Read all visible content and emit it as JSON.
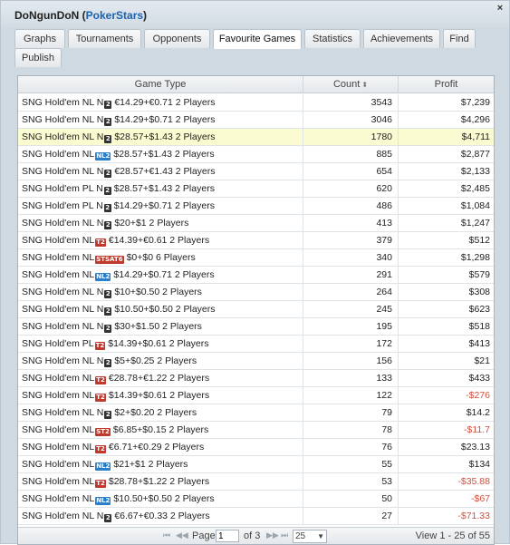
{
  "window": {
    "title": "DoNgunDoN",
    "site": "PokerStars",
    "close_glyph": "×"
  },
  "tabs": [
    {
      "label": "Graphs"
    },
    {
      "label": "Tournaments"
    },
    {
      "label": "Opponents"
    },
    {
      "label": "Favourite Games",
      "active": true
    },
    {
      "label": "Statistics"
    },
    {
      "label": "Achievements"
    },
    {
      "label": "Find"
    },
    {
      "label": "Publish"
    }
  ],
  "grid": {
    "columns": {
      "game_type": "Game Type",
      "count": "Count",
      "profit": "Profit",
      "sort_glyph": "⬍"
    },
    "rows": [
      {
        "game": "SNG Hold'em NL N",
        "badge": "n2",
        "rest": "€14.29+€0.71 2 Players",
        "count": "3543",
        "profit": "$7,239",
        "neg": false
      },
      {
        "game": "SNG Hold'em NL N",
        "badge": "n2",
        "rest": "$14.29+$0.71 2 Players",
        "count": "3046",
        "profit": "$4,296",
        "neg": false
      },
      {
        "game": "SNG Hold'em NL N",
        "badge": "n2",
        "rest": "$28.57+$1.43 2 Players",
        "count": "1780",
        "profit": "$4,711",
        "neg": false,
        "selected": true
      },
      {
        "game": "SNG Hold'em NL",
        "badge": "nl2",
        "rest": "$28.57+$1.43 2 Players",
        "count": "885",
        "profit": "$2,877",
        "neg": false
      },
      {
        "game": "SNG Hold'em NL N",
        "badge": "n2",
        "rest": "€28.57+€1.43 2 Players",
        "count": "654",
        "profit": "$2,133",
        "neg": false
      },
      {
        "game": "SNG Hold'em PL N",
        "badge": "n2",
        "rest": "$28.57+$1.43 2 Players",
        "count": "620",
        "profit": "$2,485",
        "neg": false
      },
      {
        "game": "SNG Hold'em PL N",
        "badge": "n2",
        "rest": "$14.29+$0.71 2 Players",
        "count": "486",
        "profit": "$1,084",
        "neg": false
      },
      {
        "game": "SNG Hold'em NL N",
        "badge": "n2",
        "rest": "$20+$1 2 Players",
        "count": "413",
        "profit": "$1,247",
        "neg": false
      },
      {
        "game": "SNG Hold'em NL",
        "badge": "t2",
        "rest": "€14.39+€0.61 2 Players",
        "count": "379",
        "profit": "$512",
        "neg": false
      },
      {
        "game": "SNG Hold'em NL",
        "badge": "st6",
        "rest": "$0+$0 6 Players",
        "count": "340",
        "profit": "$1,298",
        "neg": false
      },
      {
        "game": "SNG Hold'em NL",
        "badge": "nl2",
        "rest": "$14.29+$0.71 2 Players",
        "count": "291",
        "profit": "$579",
        "neg": false
      },
      {
        "game": "SNG Hold'em NL N",
        "badge": "n2",
        "rest": "$10+$0.50 2 Players",
        "count": "264",
        "profit": "$308",
        "neg": false
      },
      {
        "game": "SNG Hold'em NL N",
        "badge": "n2",
        "rest": "$10.50+$0.50 2 Players",
        "count": "245",
        "profit": "$623",
        "neg": false
      },
      {
        "game": "SNG Hold'em NL N",
        "badge": "n2",
        "rest": "$30+$1.50 2 Players",
        "count": "195",
        "profit": "$518",
        "neg": false
      },
      {
        "game": "SNG Hold'em PL",
        "badge": "t2",
        "rest": "$14.39+$0.61 2 Players",
        "count": "172",
        "profit": "$413",
        "neg": false
      },
      {
        "game": "SNG Hold'em NL N",
        "badge": "n2",
        "rest": "$5+$0.25 2 Players",
        "count": "156",
        "profit": "$21",
        "neg": false
      },
      {
        "game": "SNG Hold'em NL",
        "badge": "t2",
        "rest": "€28.78+€1.22 2 Players",
        "count": "133",
        "profit": "$433",
        "neg": false
      },
      {
        "game": "SNG Hold'em NL",
        "badge": "t2",
        "rest": "$14.39+$0.61 2 Players",
        "count": "122",
        "profit": "-$276",
        "neg": true
      },
      {
        "game": "SNG Hold'em NL N",
        "badge": "n2",
        "rest": "$2+$0.20 2 Players",
        "count": "79",
        "profit": "$14.2",
        "neg": false
      },
      {
        "game": "SNG Hold'em NL",
        "badge": "st2",
        "rest": "$6.85+$0.15 2 Players",
        "count": "78",
        "profit": "-$11.7",
        "neg": true
      },
      {
        "game": "SNG Hold'em NL",
        "badge": "t2",
        "rest": "€6.71+€0.29 2 Players",
        "count": "76",
        "profit": "$23.13",
        "neg": false
      },
      {
        "game": "SNG Hold'em NL",
        "badge": "nl2",
        "rest": "$21+$1 2 Players",
        "count": "55",
        "profit": "$134",
        "neg": false
      },
      {
        "game": "SNG Hold'em NL",
        "badge": "t2",
        "rest": "$28.78+$1.22 2 Players",
        "count": "53",
        "profit": "-$35.88",
        "neg": true
      },
      {
        "game": "SNG Hold'em NL",
        "badge": "nl2",
        "rest": "$10.50+$0.50 2 Players",
        "count": "50",
        "profit": "-$67",
        "neg": true
      },
      {
        "game": "SNG Hold'em NL N",
        "badge": "n2",
        "rest": "€6.67+€0.33 2 Players",
        "count": "27",
        "profit": "-$71.33",
        "neg": true
      }
    ],
    "badge_text": {
      "n2": "2",
      "nl2": "NL2",
      "t2": "T2",
      "st2": "ST2",
      "st6": "STSAT6"
    }
  },
  "pager": {
    "first_glyph": "⏮",
    "prev_glyph": "◀◀",
    "page_label": "Page",
    "page_value": "1",
    "of_label": "of 3",
    "next_glyph": "▶▶",
    "last_glyph": "⏭",
    "rows_per_page": "25",
    "view_text": "View 1 - 25 of 55"
  },
  "colors": {
    "selected_row": "#fbfbd1",
    "negative": "#d2503f",
    "link": "#1b62b0"
  }
}
